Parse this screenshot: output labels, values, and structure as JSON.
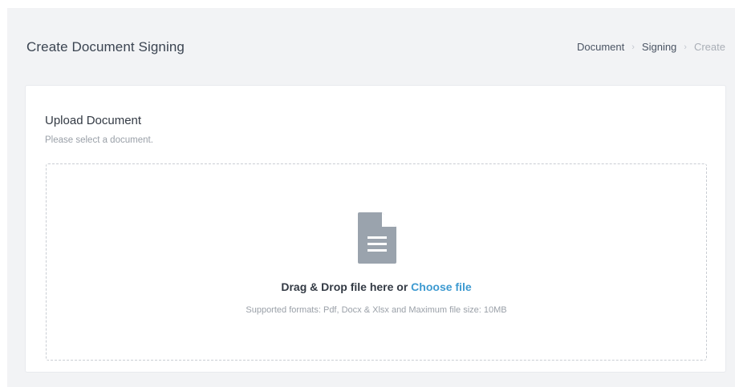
{
  "header": {
    "title": "Create Document Signing",
    "breadcrumb": [
      {
        "label": "Document"
      },
      {
        "label": "Signing"
      },
      {
        "label": "Create"
      }
    ],
    "separator": "›"
  },
  "upload": {
    "title": "Upload Document",
    "subtitle": "Please select a document.",
    "drop_prefix": "Drag & Drop file here or ",
    "choose_file_label": "Choose file",
    "formats_text": "Supported formats: Pdf, Docx & Xlsx and Maximum file size: 10MB",
    "icon": "document-icon"
  },
  "colors": {
    "accent": "#3d9ad1",
    "icon": "#9aa3ad",
    "background": "#f2f3f5"
  }
}
